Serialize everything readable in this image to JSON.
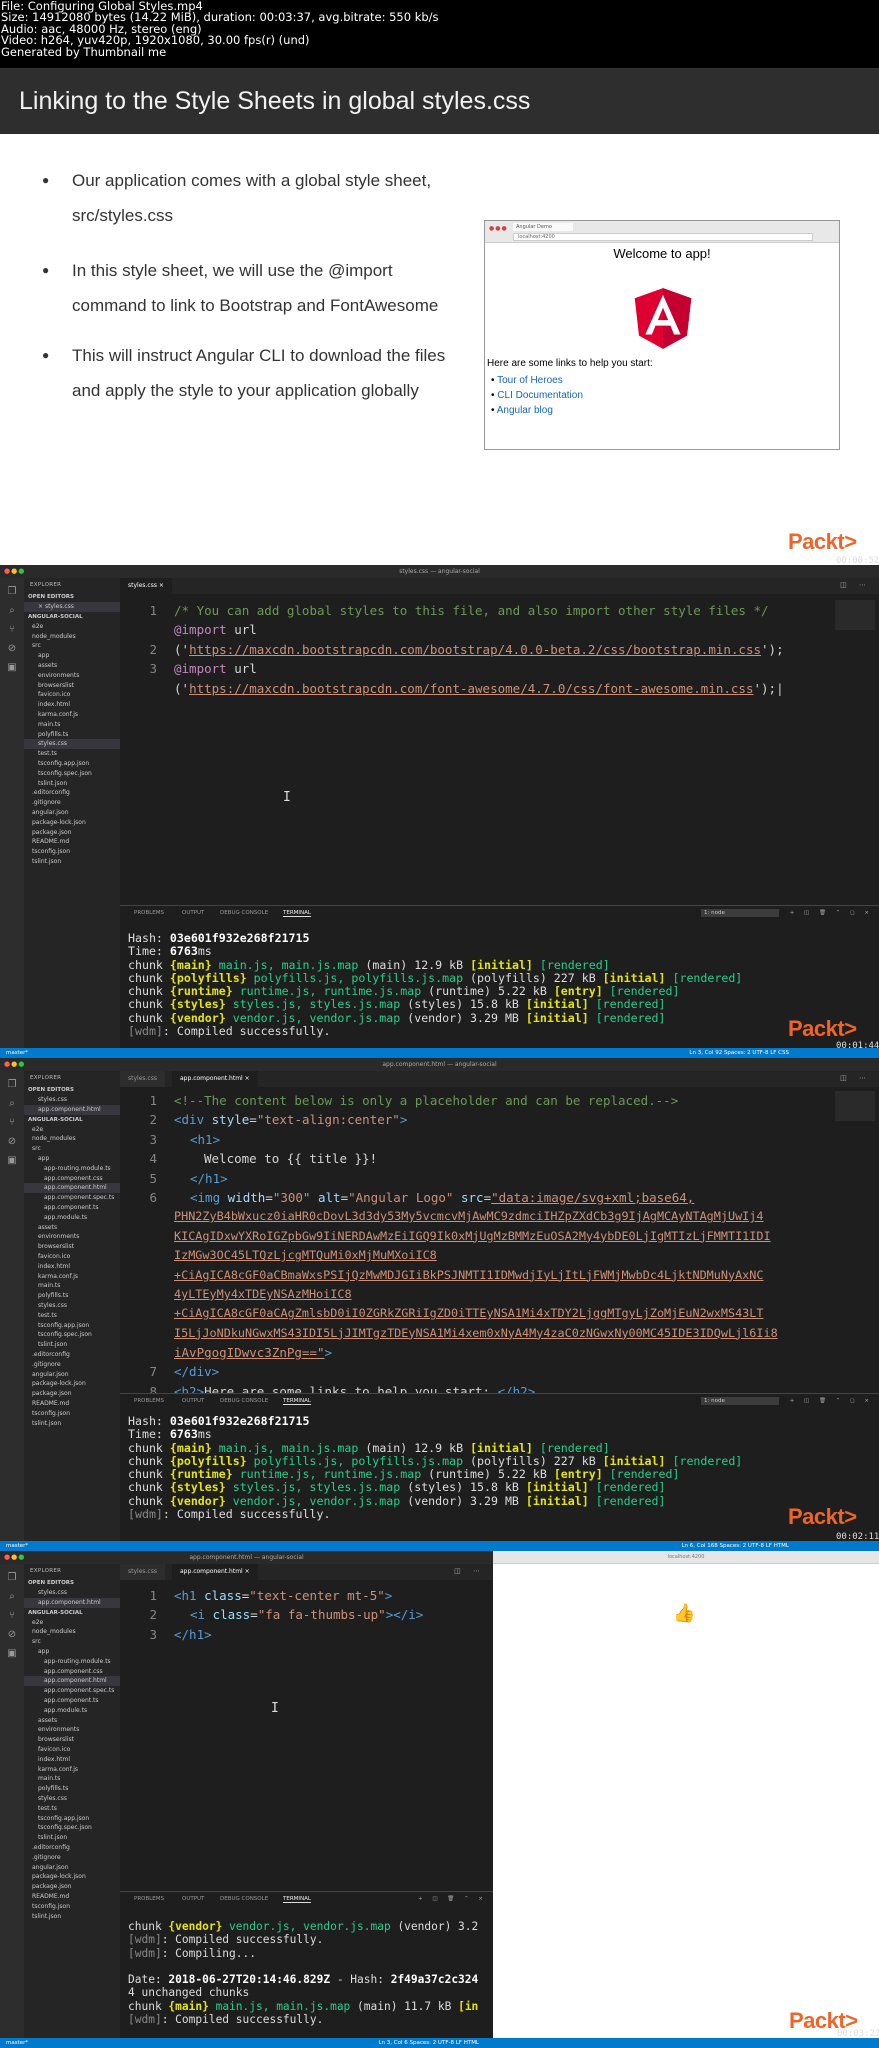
{
  "file_info": {
    "line1": "File: Configuring Global Styles.mp4",
    "line2": "Size: 14912080 bytes (14.22 MiB), duration: 00:03:37, avg.bitrate: 550 kb/s",
    "line3": "Audio: aac, 48000 Hz, stereo (eng)",
    "line4": "Video: h264, yuv420p, 1920x1080, 30.00 fps(r) (und)",
    "line5": "Generated by Thumbnail me"
  },
  "slide": {
    "title": "Linking to the Style Sheets in global styles.css",
    "bullets": [
      "Our application comes with a global style sheet, src/styles.css",
      "In this style sheet, we will use the @import command to link to Bootstrap and FontAwesome",
      "This will instruct Angular CLI to download the files and apply the style to your application globally"
    ],
    "preview": {
      "tab": "Angular Demo",
      "url": "localhost:4200",
      "heading": "Welcome to app!",
      "links_heading": "Here are some links to help you start:",
      "links": [
        "Tour of Heroes",
        "CLI Documentation",
        "Angular blog"
      ]
    },
    "logo": "Packt>",
    "timestamp": "00:00:52"
  },
  "panel1": {
    "window_title": "styles.css — angular-social",
    "tab": "styles.css",
    "code": {
      "l1": "/* You can add global styles to this file, and also import other style files */",
      "l2_kw": "@import",
      "l2_rest": " url",
      "l3_open": "('",
      "l3_url": "https://maxcdn.bootstrapcdn.com/bootstrap/4.0.0-beta.2/css/bootstrap.min.css",
      "l3_close": "');",
      "l4_kw": "@import",
      "l4_rest": " url",
      "l5_open": "('",
      "l5_url": "https://maxcdn.bootstrapcdn.com/font-awesome/4.7.0/css/font-awesome.min.css",
      "l5_close": "');"
    },
    "term": {
      "l1a": "Hash: ",
      "l1b": "03e601f932e268f21715",
      "l2a": "Time: ",
      "l2b": "6763",
      "l2c": "ms",
      "chunk": "chunk ",
      "c1": "{main}",
      "c1f": " main.js, main.js.map",
      "c1s": " (main) 12.9 kB ",
      "c1t": "[initial]",
      "c1r": " [rendered]",
      "c2": "{polyfills}",
      "c2f": " polyfills.js, polyfills.js.map",
      "c2s": " (polyfills) 227 kB ",
      "c2t": "[initial]",
      "c2r": " [rendered]",
      "c3": "{runtime}",
      "c3f": " runtime.js, runtime.js.map",
      "c3s": " (runtime) 5.22 kB ",
      "c3t": "[entry]",
      "c3r": " [rendered]",
      "c4": "{styles}",
      "c4f": " styles.js, styles.js.map",
      "c4s": " (styles) 15.8 kB ",
      "c4t": "[initial]",
      "c4r": " [rendered]",
      "c5": "{vendor}",
      "c5f": " vendor.js, vendor.js.map",
      "c5s": " (vendor) 3.29 MB ",
      "c5t": "[initial]",
      "c5r": " [rendered]",
      "wdm": "[wdm]",
      "compiled": ": Compiled successfully."
    },
    "timestamp": "00:01:44",
    "status": "Ln 3, Col 92   Spaces: 2   UTF-8   LF   CSS"
  },
  "panel2": {
    "window_title": "app.component.html — angular-social",
    "tab1": "styles.css",
    "tab2": "app.component.html",
    "l1": "<!--The content below is only a placeholder and can be replaced.-->",
    "l2_open": "<div ",
    "l2_attr": "style",
    "l2_eq": "=",
    "l2_val": "\"text-align:center\"",
    "l2_close": ">",
    "l3": "<h1>",
    "l4": "Welcome to {{ title }}!",
    "l5": "</h1>",
    "l6_open": "<img ",
    "l6_a1": "width",
    "l6_v1": "\"300\"",
    "l6_a2": "alt",
    "l6_v2": "\"Angular Logo\"",
    "l6_a3": "src",
    "l6_v3": "\"data:image/svg+xml;base64,",
    "d1": "PHN2ZyB4bWxucz0iaHR0cDovL3d3dy53My5vcmcvMjAwMC9zdmciIHZpZXdCb3g9IjAgMCAyNTAgMjUwIj4",
    "d2": "KICAgIDxwYXRoIGZpbGw9IiNERDAwMzEiIGQ9Ik0xMjUgMzBMMzEuOSA2My4ybDE0LjIgMTIzLjFMMTI1IDI",
    "d3": "IzMGw3OC45LTQzLjcgMTQuMi0xMjMuMXoiIC8",
    "d4": "+CiAgICA8cGF0aCBmaWxsPSIjQzMwMDJGIiBkPSJNMTI1IDMwdjIyLjItLjFWMjMwbDc4LjktNDMuNyAxNC",
    "d5": "4yLTEyMy4xTDEyNSAzMHoiIC8",
    "d6": "+CiAgICA8cGF0aCAgZmlsbD0iI0ZGRkZGRiIgZD0iTTEyNSA1Mi4xTDY2LjggMTgyLjZoMjEuN2wxMS43LT",
    "d7": "I5LjJoNDkuNGwxMS43IDI5LjJIMTgzTDEyNSA1Mi4xem0xNyA4My4zaC0zNGwxNy00MC45IDE3IDQwLjl6Ii8",
    "d8": "iAvPgogIDwvc3ZnPg==\"",
    "d8c": ">",
    "l7": "</div>",
    "l8_open": "<h2>",
    "l8_text": "Here are some links to help you start: ",
    "l8_close": "</h2>",
    "timestamp": "00:02:11",
    "status": "Ln 6, Col 168   Spaces: 2   UTF-8   LF   HTML"
  },
  "panel3": {
    "window_title": "app.component.html — angular-social",
    "tab1": "styles.css",
    "tab2": "app.component.html",
    "l1_open": "<h1 ",
    "l1_attr": "class",
    "l1_val": "\"text-center mt-5\"",
    "l1_close": ">",
    "l2_open": "<i ",
    "l2_attr": "class",
    "l2_val": "\"fa fa-thumbs-up\"",
    "l2_close": "></i>",
    "l3": "</h1>",
    "browser_url": "localhost:4200",
    "term": {
      "l1a": "chunk ",
      "l1b": "{vendor}",
      "l1c": " vendor.js, vendor.js.map",
      "l1d": " (vendor) 3.2",
      "l2": "[wdm]",
      "l2b": ": Compiled successfully.",
      "l3": "[wdm]",
      "l3b": ": Compiling...",
      "l4": "",
      "l5a": "Date: ",
      "l5b": "2018-06-27T20:14:46.829Z",
      "l5c": " - Hash: ",
      "l5d": "2f49a37c2c324",
      "l6": "4 unchanged chunks",
      "l7a": "chunk ",
      "l7b": "{main}",
      "l7c": " main.js, main.js.map",
      "l7d": " (main) 11.7 kB ",
      "l7e": "[in",
      "l8": "[wdm]",
      "l8b": ": Compiled successfully."
    },
    "timestamp": "00:03:23",
    "status": "Ln 3, Col 6   Spaces: 2   UTF-8   LF   HTML"
  },
  "explorer": {
    "header": "EXPLORER",
    "open_editors": "OPEN EDITORS",
    "project": "ANGULAR-SOCIAL",
    "items": [
      "e2e",
      "node_modules",
      "src",
      "app",
      "assets",
      "environments",
      "browserslist",
      "favicon.ico",
      "index.html",
      "karma.conf.js",
      "main.ts",
      "polyfills.ts",
      "styles.css",
      "test.ts",
      "tsconfig.app.json",
      "tsconfig.spec.json",
      "tslint.json",
      ".editorconfig",
      ".gitignore",
      "angular.json",
      "package-lock.json",
      "package.json",
      "README.md",
      "tsconfig.json",
      "tslint.json"
    ],
    "app_items": [
      "app-routing.module.ts",
      "app.component.css",
      "app.component.html",
      "app.component.spec.ts",
      "app.component.ts",
      "app.module.ts"
    ]
  },
  "terminal_tabs": [
    "PROBLEMS",
    "OUTPUT",
    "DEBUG CONSOLE",
    "TERMINAL"
  ],
  "terminal_select": "1: node",
  "branch": "master*",
  "colors": {
    "accent": "#f0642a",
    "status": "#007acc"
  }
}
